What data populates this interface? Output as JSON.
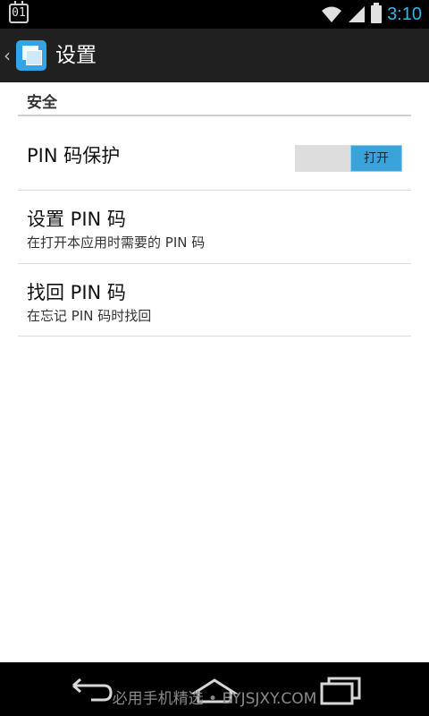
{
  "status_bar": {
    "date_badge": "01",
    "time": "3:10"
  },
  "action_bar": {
    "title": "设置",
    "icons": {
      "back": "chevron-left-icon",
      "app": "app-icon"
    }
  },
  "category": {
    "label": "安全"
  },
  "prefs": [
    {
      "title": "PIN 码保护",
      "switch_label": "打开",
      "switch_on": true
    },
    {
      "title": "设置 PIN 码",
      "summary": "在打开本应用时需要的 PIN 码"
    },
    {
      "title": "找回 PIN 码",
      "summary": "在忘记 PIN 码时找回"
    }
  ],
  "nav_bar": {
    "watermark": "必用手机精选 • BYJSJXY.COM",
    "icons": [
      "back-icon",
      "home-icon",
      "recent-apps-icon"
    ]
  },
  "colors": {
    "accent": "#33b5e5",
    "switch_on": "#3aa3d9",
    "action_bar": "#202020"
  }
}
